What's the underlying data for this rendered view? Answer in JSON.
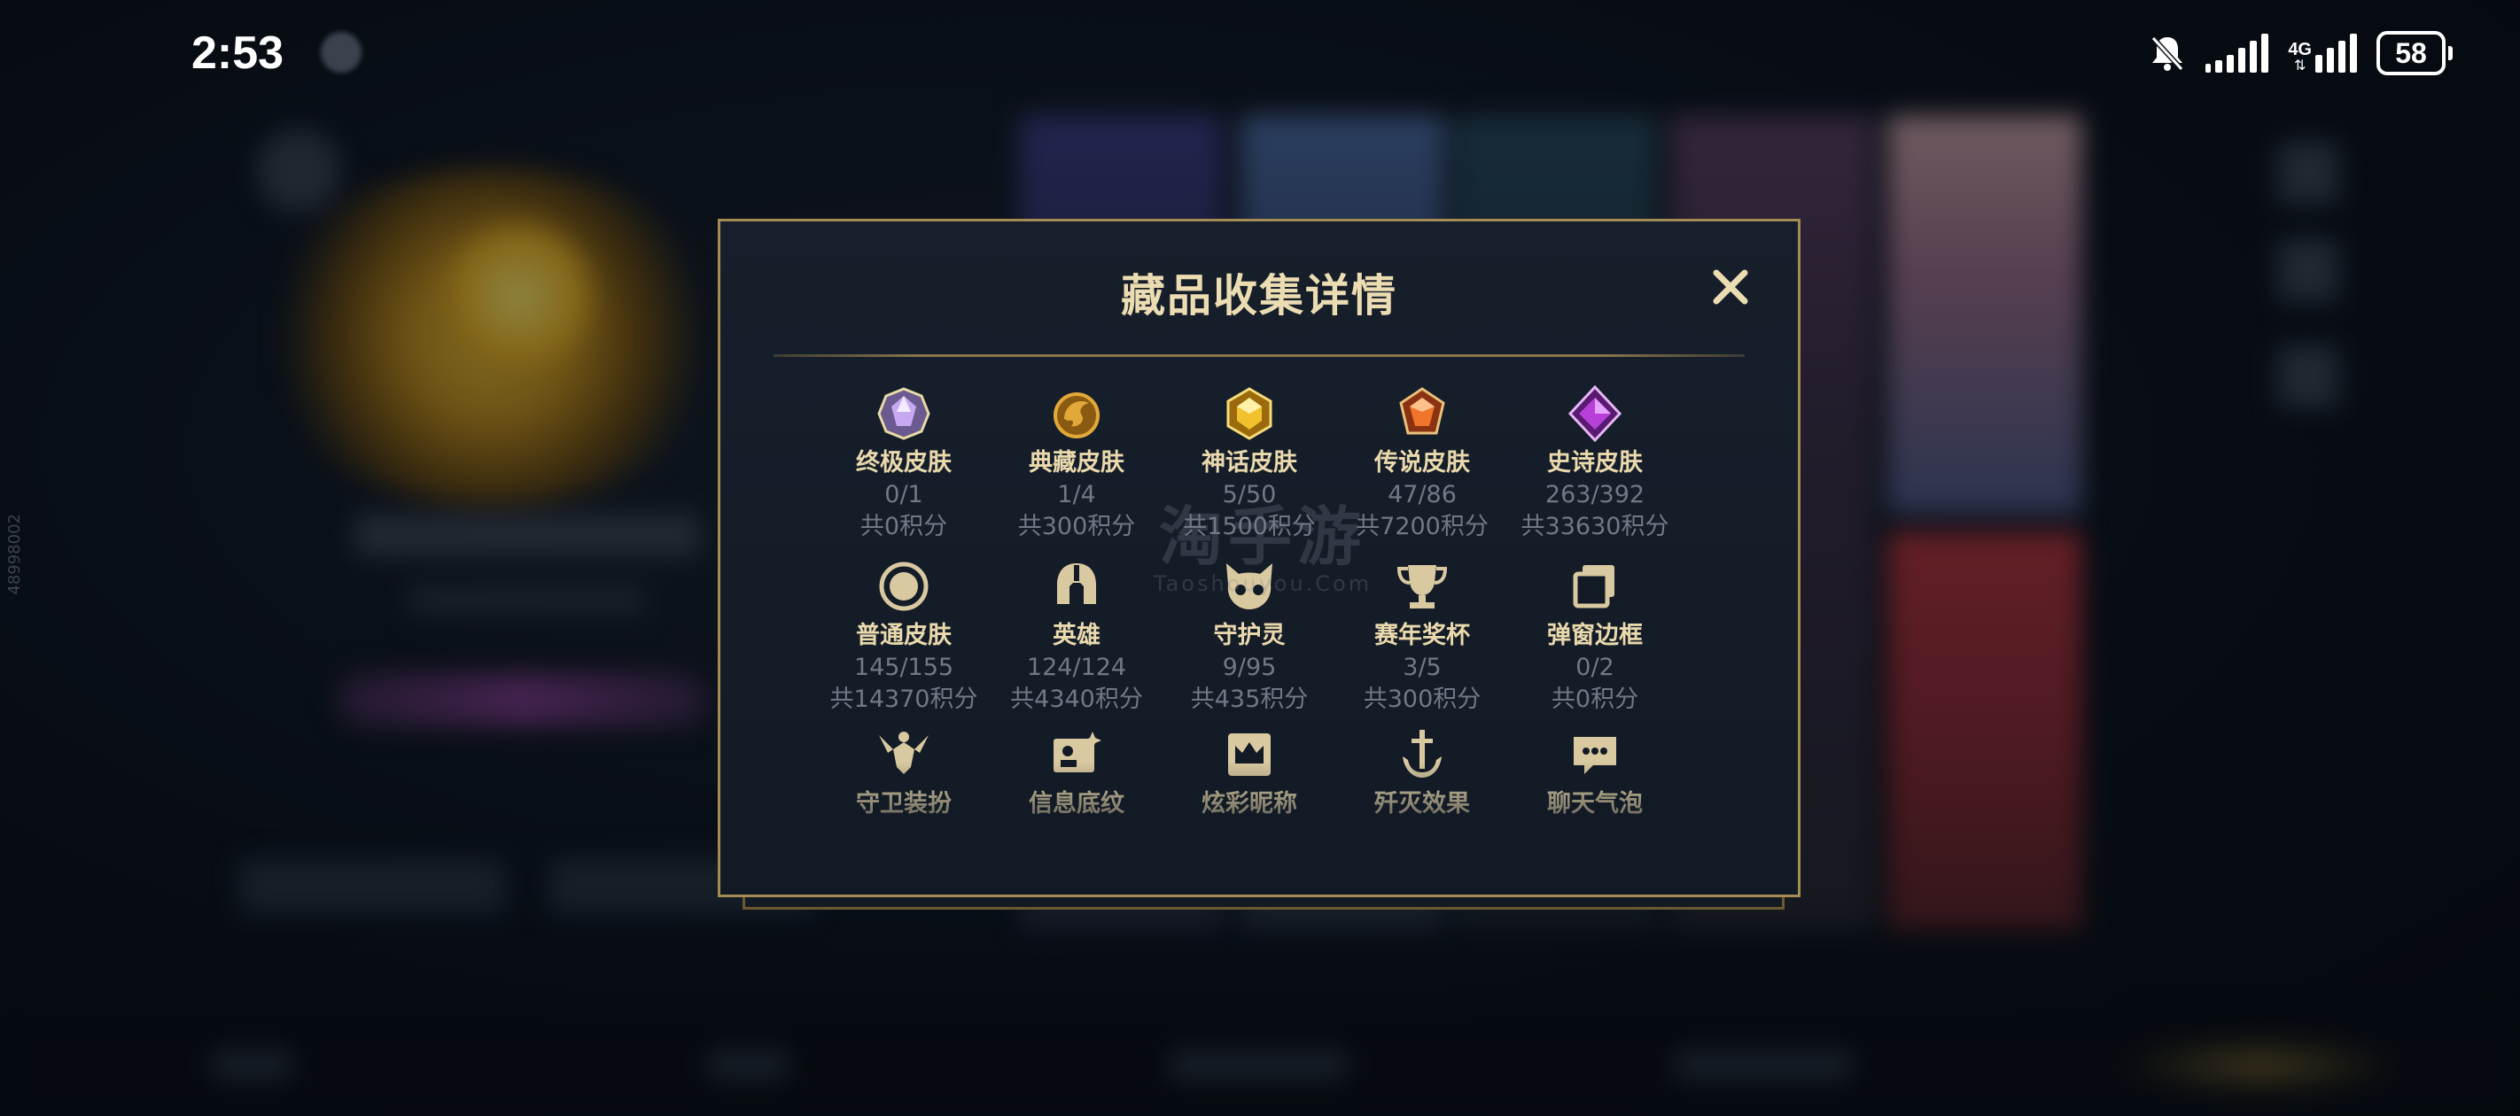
{
  "status_bar": {
    "time": "2:53",
    "network_type": "4G",
    "battery": "58",
    "icons": [
      "settings-icon",
      "mute-bell-icon",
      "signal-icon",
      "signal-4g-icon",
      "battery-icon"
    ]
  },
  "side_id": "48998002",
  "watermark": {
    "main": "淘手游",
    "sub": "Taoshouyou.Com"
  },
  "dialog": {
    "title": "藏品收集详情",
    "close_icon": "close-icon",
    "rows": [
      [
        {
          "label": "终极皮肤",
          "count": "0/1",
          "points": "共0积分",
          "icon": "ultimate-skin-icon",
          "color": "#c7a9f2"
        },
        {
          "label": "典藏皮肤",
          "count": "1/4",
          "points": "共300积分",
          "icon": "collection-skin-icon",
          "color": "#e3a83a"
        },
        {
          "label": "神话皮肤",
          "count": "5/50",
          "points": "共1500积分",
          "icon": "mythic-skin-icon",
          "color": "#f2c22e"
        },
        {
          "label": "传说皮肤",
          "count": "47/86",
          "points": "共7200积分",
          "icon": "legendary-skin-icon",
          "color": "#f0742a"
        },
        {
          "label": "史诗皮肤",
          "count": "263/392",
          "points": "共33630积分",
          "icon": "epic-skin-icon",
          "color": "#b640d8"
        }
      ],
      [
        {
          "label": "普通皮肤",
          "count": "145/155",
          "points": "共14370积分",
          "icon": "normal-skin-icon",
          "color": "#d9c9a0"
        },
        {
          "label": "英雄",
          "count": "124/124",
          "points": "共4340积分",
          "icon": "hero-helmet-icon",
          "color": "#d9c9a0"
        },
        {
          "label": "守护灵",
          "count": "9/95",
          "points": "共435积分",
          "icon": "guardian-spirit-icon",
          "color": "#d9c9a0"
        },
        {
          "label": "赛年奖杯",
          "count": "3/5",
          "points": "共300积分",
          "icon": "trophy-icon",
          "color": "#d9c9a0"
        },
        {
          "label": "弹窗边框",
          "count": "0/2",
          "points": "共0积分",
          "icon": "popup-frame-icon",
          "color": "#d9c9a0"
        }
      ],
      [
        {
          "label": "守卫装扮",
          "icon": "guard-outfit-icon",
          "color": "#d9c9a0"
        },
        {
          "label": "信息底纹",
          "icon": "info-background-icon",
          "color": "#d9c9a0"
        },
        {
          "label": "炫彩昵称",
          "icon": "colorful-nickname-icon",
          "color": "#d9c9a0"
        },
        {
          "label": "歼灭效果",
          "icon": "kill-effect-icon",
          "color": "#d9c9a0"
        },
        {
          "label": "聊天气泡",
          "icon": "chat-bubble-icon",
          "color": "#d9c9a0"
        }
      ]
    ]
  }
}
